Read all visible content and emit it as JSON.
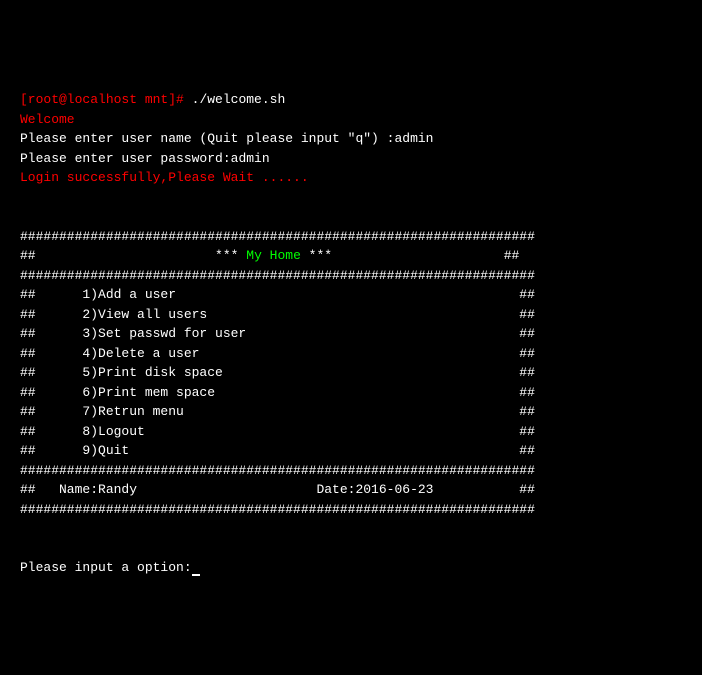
{
  "prompt": {
    "user_host": "[root@localhost mnt]# ",
    "command": "./welcome.sh"
  },
  "welcome_text": "Welcome",
  "username_prompt": "Please enter user name (Quit please input \"q\") :",
  "username_value": "admin",
  "password_prompt": "Please enter user password:",
  "password_value": "admin",
  "login_success": "Login successfully,Please Wait ......",
  "border_full": "##################################################################",
  "menu_header_left": "##                       ",
  "menu_header_stars_left": "*** ",
  "menu_header_title": "My Home",
  "menu_header_stars_right": " ***",
  "menu_header_right": "                      ##",
  "menu_items": [
    "##      1)Add a user                                            ##",
    "##      2)View all users                                        ##",
    "##      3)Set passwd for user                                   ##",
    "##      4)Delete a user                                         ##",
    "##      5)Print disk space                                      ##",
    "##      6)Print mem space                                       ##",
    "##      7)Retrun menu                                           ##",
    "##      8)Logout                                                ##",
    "##      9)Quit                                                  ##"
  ],
  "footer_line": "##   Name:Randy                       Date:2016-06-23           ##",
  "input_prompt": "Please input a option:"
}
